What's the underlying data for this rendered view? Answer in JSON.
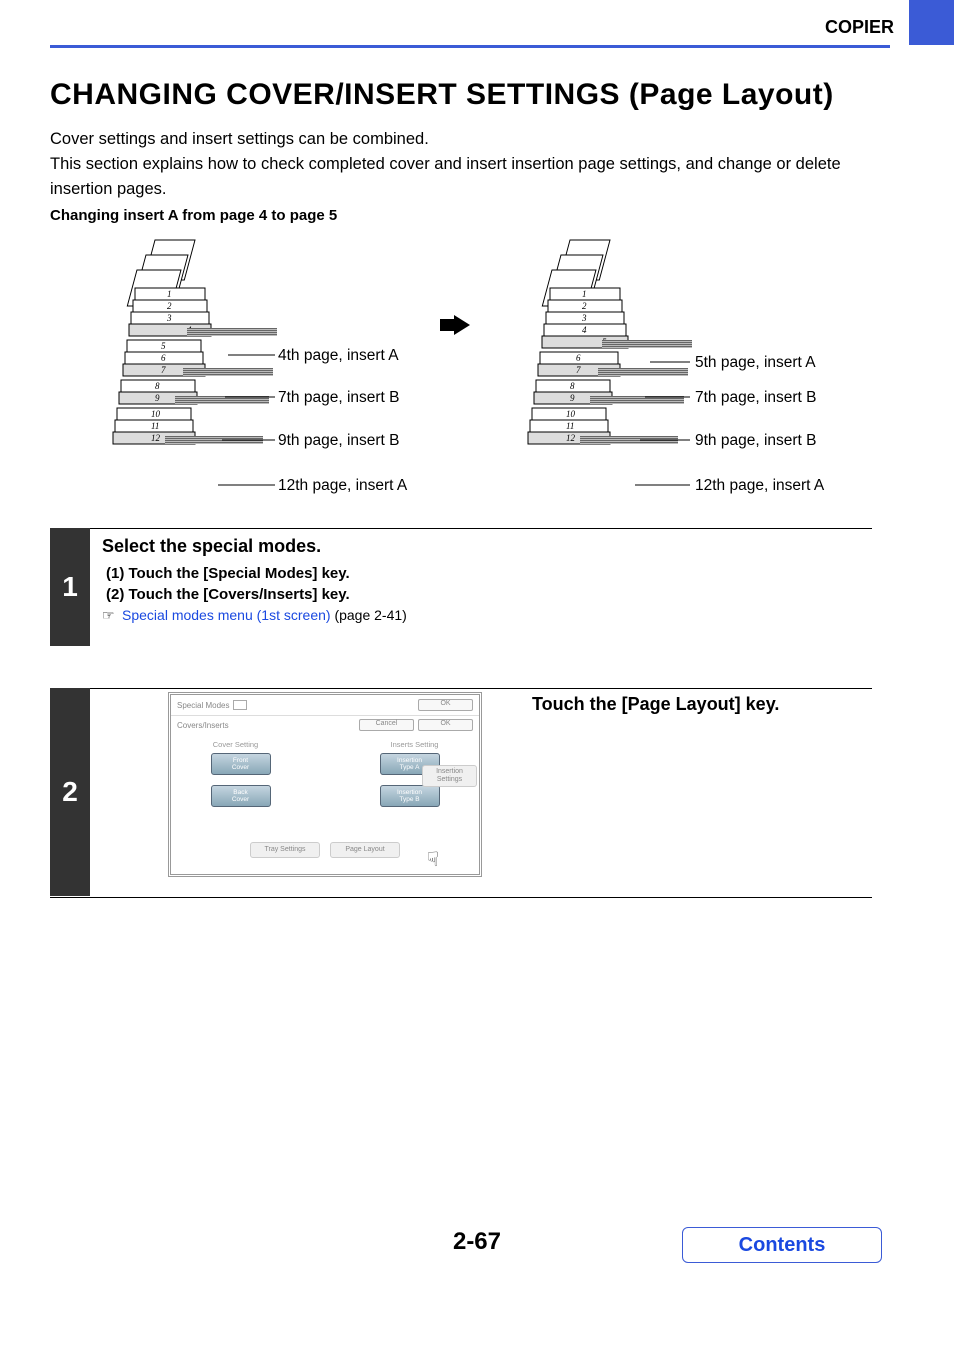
{
  "header": {
    "section": "COPIER"
  },
  "title": "CHANGING COVER/INSERT SETTINGS (Page Layout)",
  "intro": "Cover settings and insert settings can be combined.\nThis section explains how to check completed cover and insert insertion page settings, and change or delete insertion pages.",
  "subheading": "Changing insert A from page 4 to page 5",
  "diagram": {
    "left": {
      "pages": [
        "1",
        "2",
        "3",
        "4",
        "5",
        "6",
        "7",
        "8",
        "9",
        "10",
        "11",
        "12"
      ],
      "callouts": [
        {
          "text": "4th page, insert A"
        },
        {
          "text": "7th page, insert B"
        },
        {
          "text": "9th page, insert B"
        },
        {
          "text": "12th page, insert A"
        }
      ]
    },
    "right": {
      "pages": [
        "1",
        "2",
        "3",
        "4",
        "5",
        "6",
        "7",
        "8",
        "9",
        "10",
        "11",
        "12"
      ],
      "callouts": [
        {
          "text": "5th page, insert A"
        },
        {
          "text": "7th page, insert B"
        },
        {
          "text": "9th page, insert B"
        },
        {
          "text": "12th page, insert A"
        }
      ]
    }
  },
  "steps": [
    {
      "num": "1",
      "title": "Select the special modes.",
      "items": [
        "(1)  Touch the [Special Modes] key.",
        "(2)  Touch the [Covers/Inserts] key."
      ],
      "link": "Special modes menu (1st screen)",
      "link_suffix": " (page 2-41)"
    },
    {
      "num": "2",
      "title": "Touch the [Page Layout] key."
    }
  ],
  "panel": {
    "header": "Special Modes",
    "ok": "OK",
    "sub": "Covers/Inserts",
    "cancel": "Cancel",
    "left_heading": "Cover Setting",
    "right_heading": "Inserts Setting",
    "front_cover": "Front\nCover",
    "back_cover": "Back\nCover",
    "ins_a": "Insertion\nType A",
    "ins_b": "Insertion\nType B",
    "ins_settings": "Insertion\nSettings",
    "tray": "Tray Settings",
    "page_layout": "Page Layout"
  },
  "pageNumber": "2-67",
  "contents": "Contents"
}
